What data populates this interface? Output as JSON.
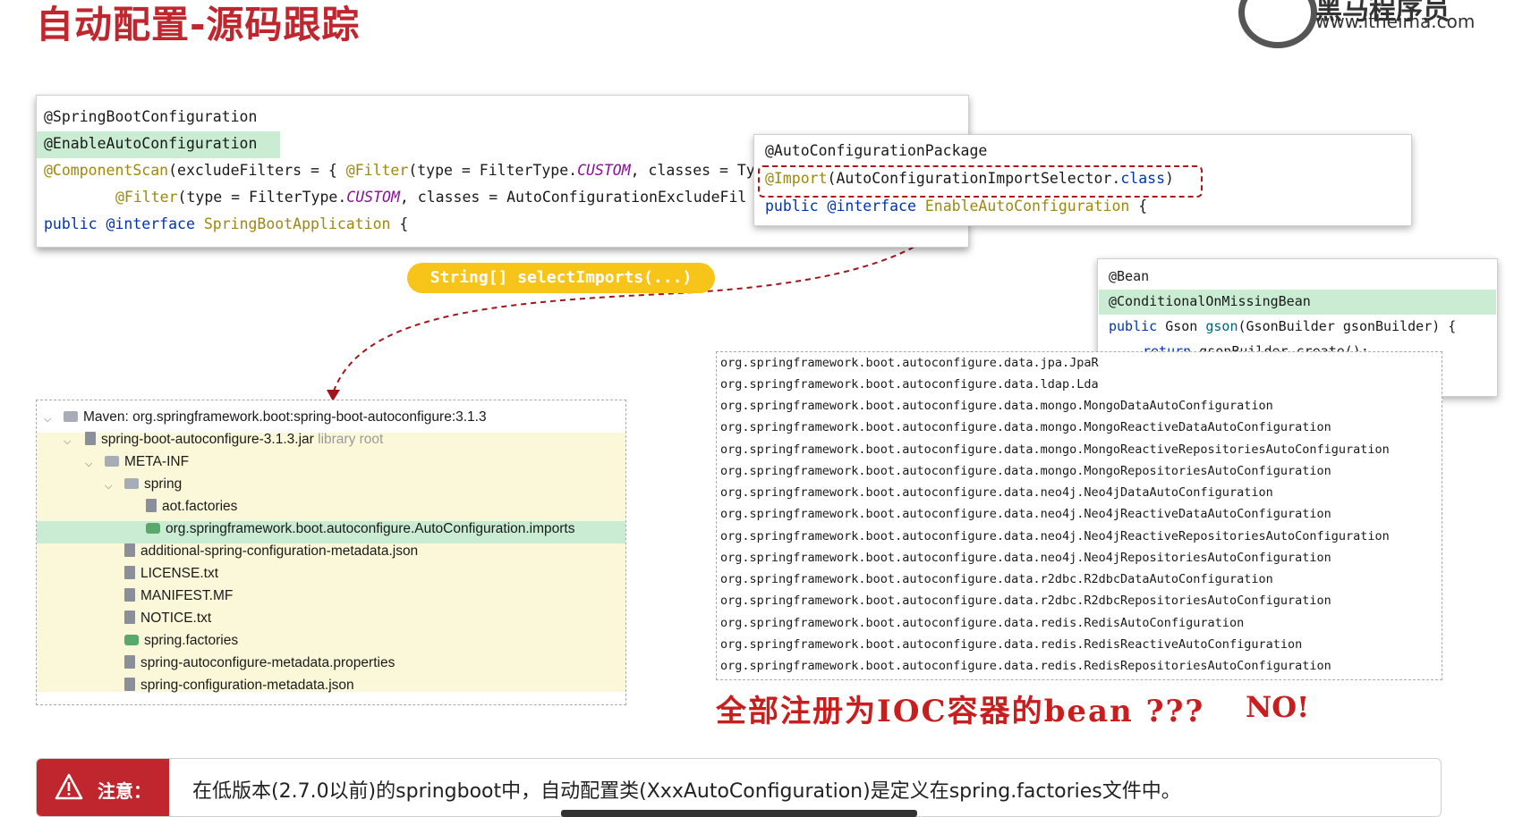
{
  "slide": {
    "title": "自动配置-源码跟踪",
    "logo_brand": "黑马程序员",
    "logo_url": "www.itheima.com"
  },
  "code_springboot": {
    "line1": "@SpringBootConfiguration",
    "line2": "@EnableAutoConfiguration",
    "line3_anno": "@ComponentScan",
    "line3_rest": "(excludeFilters = { ",
    "line3_filter": "@Filter",
    "line3_type": "(type = FilterType.",
    "line3_custom": "CUSTOM",
    "line3_end": ", classes = Ty",
    "line4_filter": "@Filter",
    "line4_type": "(type = FilterType.",
    "line4_custom": "CUSTOM",
    "line4_end": ", classes = AutoConfigurationExcludeFil",
    "line5_kw1": "public ",
    "line5_kw2": "@interface ",
    "line5_name": "SpringBootApplication",
    "line5_end": " {"
  },
  "code_enable": {
    "line1": "@AutoConfigurationPackage",
    "line2_anno": "@Import",
    "line2_rest": "(AutoConfigurationImportSelector.",
    "line2_kw": "class",
    "line2_end": ")",
    "line3_kw1": "public ",
    "line3_kw2": "@interface ",
    "line3_name": "EnableAutoConfiguration",
    "line3_end": " {"
  },
  "method_pill": "String[] selectImports(...)",
  "code_bean": {
    "line1": "@Bean",
    "line2": "@ConditionalOnMissingBean",
    "line3_kw": "public ",
    "line3_type": "Gson ",
    "line3_name": "gson",
    "line3_rest": "(GsonBuilder gsonBuilder) {",
    "line4_kw": "return ",
    "line4_rest": "gsonBuilder.create();",
    "line5": "}"
  },
  "tree": {
    "root": "Maven: org.springframework.boot:spring-boot-autoconfigure:3.1.3",
    "jar": "spring-boot-autoconfigure-3.1.3.jar",
    "jar_suffix": "library root",
    "meta_inf": "META-INF",
    "spring": "spring",
    "aot": "aot.factories",
    "imports": "org.springframework.boot.autoconfigure.AutoConfiguration.imports",
    "files": [
      "additional-spring-configuration-metadata.json",
      "LICENSE.txt",
      "MANIFEST.MF",
      "NOTICE.txt",
      "spring.factories",
      "spring-autoconfigure-metadata.properties",
      "spring-configuration-metadata.json"
    ]
  },
  "imports_list": [
    "org.springframework.boot.autoconfigure.data.jpa.JpaR",
    "org.springframework.boot.autoconfigure.data.ldap.Lda",
    "org.springframework.boot.autoconfigure.data.mongo.MongoDataAutoConfiguration",
    "org.springframework.boot.autoconfigure.data.mongo.MongoReactiveDataAutoConfiguration",
    "org.springframework.boot.autoconfigure.data.mongo.MongoReactiveRepositoriesAutoConfiguration",
    "org.springframework.boot.autoconfigure.data.mongo.MongoRepositoriesAutoConfiguration",
    "org.springframework.boot.autoconfigure.data.neo4j.Neo4jDataAutoConfiguration",
    "org.springframework.boot.autoconfigure.data.neo4j.Neo4jReactiveDataAutoConfiguration",
    "org.springframework.boot.autoconfigure.data.neo4j.Neo4jReactiveRepositoriesAutoConfiguration",
    "org.springframework.boot.autoconfigure.data.neo4j.Neo4jRepositoriesAutoConfiguration",
    "org.springframework.boot.autoconfigure.data.r2dbc.R2dbcDataAutoConfiguration",
    "org.springframework.boot.autoconfigure.data.r2dbc.R2dbcRepositoriesAutoConfiguration",
    "org.springframework.boot.autoconfigure.data.redis.RedisAutoConfiguration",
    "org.springframework.boot.autoconfigure.data.redis.RedisReactiveAutoConfiguration",
    "org.springframework.boot.autoconfigure.data.redis.RedisRepositoriesAutoConfiguration"
  ],
  "callout": {
    "question": "全部注册为IOC容器的bean ???",
    "answer": "NO!"
  },
  "notice": {
    "label": "注意：",
    "text": "在低版本(2.7.0以前)的springboot中，自动配置类(XxxAutoConfiguration)是定义在spring.factories文件中。"
  },
  "colors": {
    "brand_red": "#c0262d",
    "highlight_green": "#c9ecd2",
    "pill_yellow": "#f7c51a",
    "tree_bg": "#fbf8d9"
  }
}
